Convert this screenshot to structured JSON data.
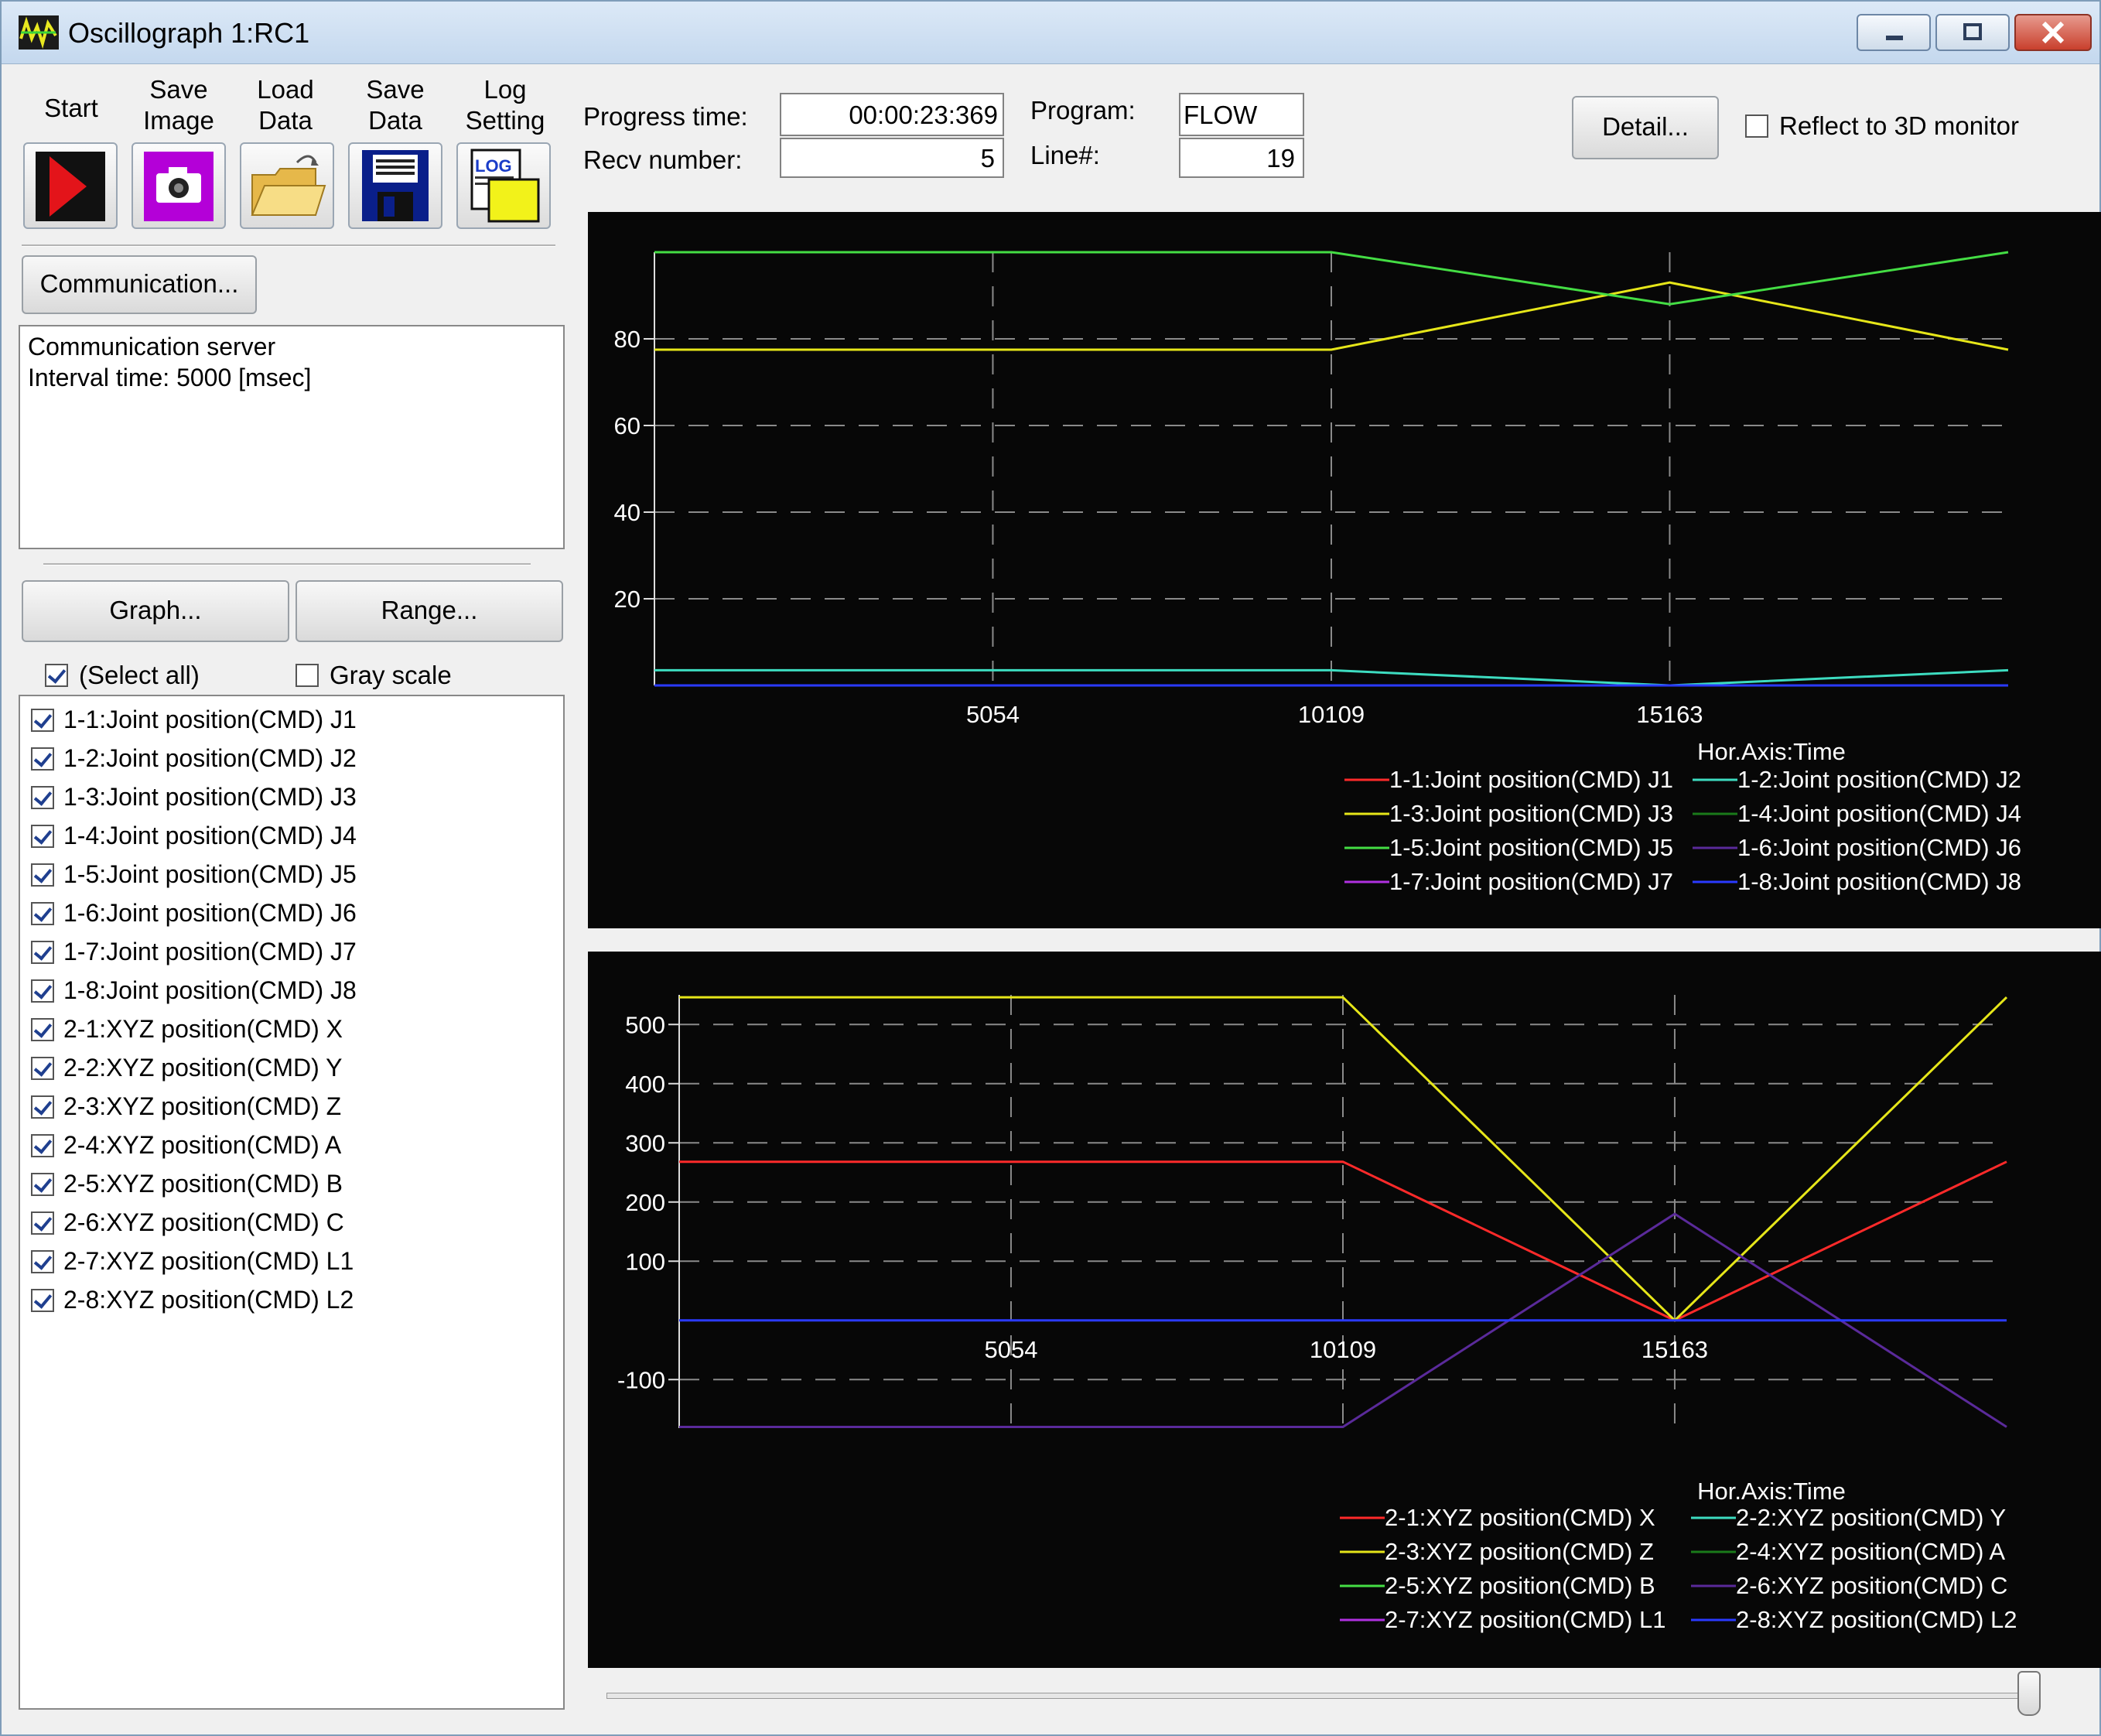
{
  "window": {
    "title": "Oscillograph 1:RC1"
  },
  "toolbar": [
    {
      "label_1": "Start",
      "label_2": ""
    },
    {
      "label_1": "Save",
      "label_2": "Image"
    },
    {
      "label_1": "Load",
      "label_2": "Data"
    },
    {
      "label_1": "Save",
      "label_2": "Data"
    },
    {
      "label_1": "Log",
      "label_2": "Setting"
    }
  ],
  "communication": {
    "button": "Communication...",
    "info_line1": "Communication server",
    "info_line2": "Interval time: 5000 [msec]"
  },
  "graph_button": "Graph...",
  "range_button": "Range...",
  "select_all": {
    "label": "(Select all)",
    "checked": true
  },
  "gray_scale": {
    "label": "Gray scale",
    "checked": false
  },
  "status": {
    "progress_label": "Progress time:",
    "progress_value": "00:00:23:369",
    "recv_label": "Recv number:",
    "recv_value": "5",
    "program_label": "Program:",
    "program_value": "FLOW",
    "line_label": "Line#:",
    "line_value": "19"
  },
  "detail_button": "Detail...",
  "reflect_3d": {
    "label": "Reflect to 3D monitor",
    "checked": false
  },
  "signals": [
    "1-1:Joint position(CMD) J1",
    "1-2:Joint position(CMD) J2",
    "1-3:Joint position(CMD) J3",
    "1-4:Joint position(CMD) J4",
    "1-5:Joint position(CMD) J5",
    "1-6:Joint position(CMD) J6",
    "1-7:Joint position(CMD) J7",
    "1-8:Joint position(CMD) J8",
    "2-1:XYZ position(CMD) X",
    "2-2:XYZ position(CMD) Y",
    "2-3:XYZ position(CMD) Z",
    "2-4:XYZ position(CMD) A",
    "2-5:XYZ position(CMD) B",
    "2-6:XYZ position(CMD) C",
    "2-7:XYZ position(CMD) L1",
    "2-8:XYZ position(CMD) L2"
  ],
  "chart_data": [
    {
      "type": "line",
      "xlabel": "Hor.Axis:Time",
      "xticks": [
        5054,
        10109,
        15163
      ],
      "yticks": [
        20,
        40,
        60,
        80
      ],
      "xlim": [
        0,
        20218
      ],
      "ylim": [
        0,
        100
      ],
      "series": [
        {
          "name": "1-1:Joint position(CMD) J1",
          "color": "#ff2a2a",
          "x": [],
          "y": []
        },
        {
          "name": "1-2:Joint position(CMD) J2",
          "color": "#3ddcc0",
          "x": [
            0,
            10109,
            15163,
            20218
          ],
          "y": [
            3.5,
            3.5,
            0,
            3.5
          ]
        },
        {
          "name": "1-3:Joint position(CMD) J3",
          "color": "#e6e619",
          "x": [
            0,
            10109,
            15163,
            20218
          ],
          "y": [
            77.5,
            77.5,
            93,
            77.5
          ]
        },
        {
          "name": "1-4:Joint position(CMD) J4",
          "color": "#1a7a1a",
          "x": [],
          "y": []
        },
        {
          "name": "1-5:Joint position(CMD) J5",
          "color": "#44dd44",
          "x": [
            0,
            10109,
            15163,
            20218
          ],
          "y": [
            100,
            100,
            88,
            100
          ]
        },
        {
          "name": "1-6:Joint position(CMD) J6",
          "color": "#5a2a9a",
          "x": [],
          "y": []
        },
        {
          "name": "1-7:Joint position(CMD) J7",
          "color": "#b030e0",
          "x": [],
          "y": []
        },
        {
          "name": "1-8:Joint position(CMD) J8",
          "color": "#2a3aff",
          "x": [
            0,
            20218
          ],
          "y": [
            0,
            0
          ]
        }
      ]
    },
    {
      "type": "line",
      "xlabel": "Hor.Axis:Time",
      "xticks": [
        5054,
        10109,
        15163
      ],
      "yticks": [
        -100,
        100,
        200,
        300,
        400,
        500
      ],
      "xlim": [
        0,
        20218
      ],
      "ylim": [
        -182,
        550
      ],
      "series": [
        {
          "name": "2-1:XYZ position(CMD) X",
          "color": "#ff2a2a",
          "x": [
            0,
            10109,
            15163,
            20218
          ],
          "y": [
            268,
            268,
            0,
            268
          ]
        },
        {
          "name": "2-2:XYZ position(CMD) Y",
          "color": "#3ddcc0",
          "x": [],
          "y": []
        },
        {
          "name": "2-3:XYZ position(CMD) Z",
          "color": "#e6e619",
          "x": [
            0,
            10109,
            15163,
            20218
          ],
          "y": [
            546,
            546,
            0,
            546
          ]
        },
        {
          "name": "2-4:XYZ position(CMD) A",
          "color": "#1a7a1a",
          "x": [],
          "y": []
        },
        {
          "name": "2-5:XYZ position(CMD) B",
          "color": "#44dd44",
          "x": [],
          "y": []
        },
        {
          "name": "2-6:XYZ position(CMD) C",
          "color": "#5a2a9a",
          "x": [
            0,
            10109,
            15163,
            20218
          ],
          "y": [
            -180,
            -180,
            180,
            -180
          ]
        },
        {
          "name": "2-7:XYZ position(CMD) L1",
          "color": "#b030e0",
          "x": [],
          "y": []
        },
        {
          "name": "2-8:XYZ position(CMD) L2",
          "color": "#2a3aff",
          "x": [
            0,
            20218
          ],
          "y": [
            0,
            0
          ]
        }
      ]
    }
  ]
}
